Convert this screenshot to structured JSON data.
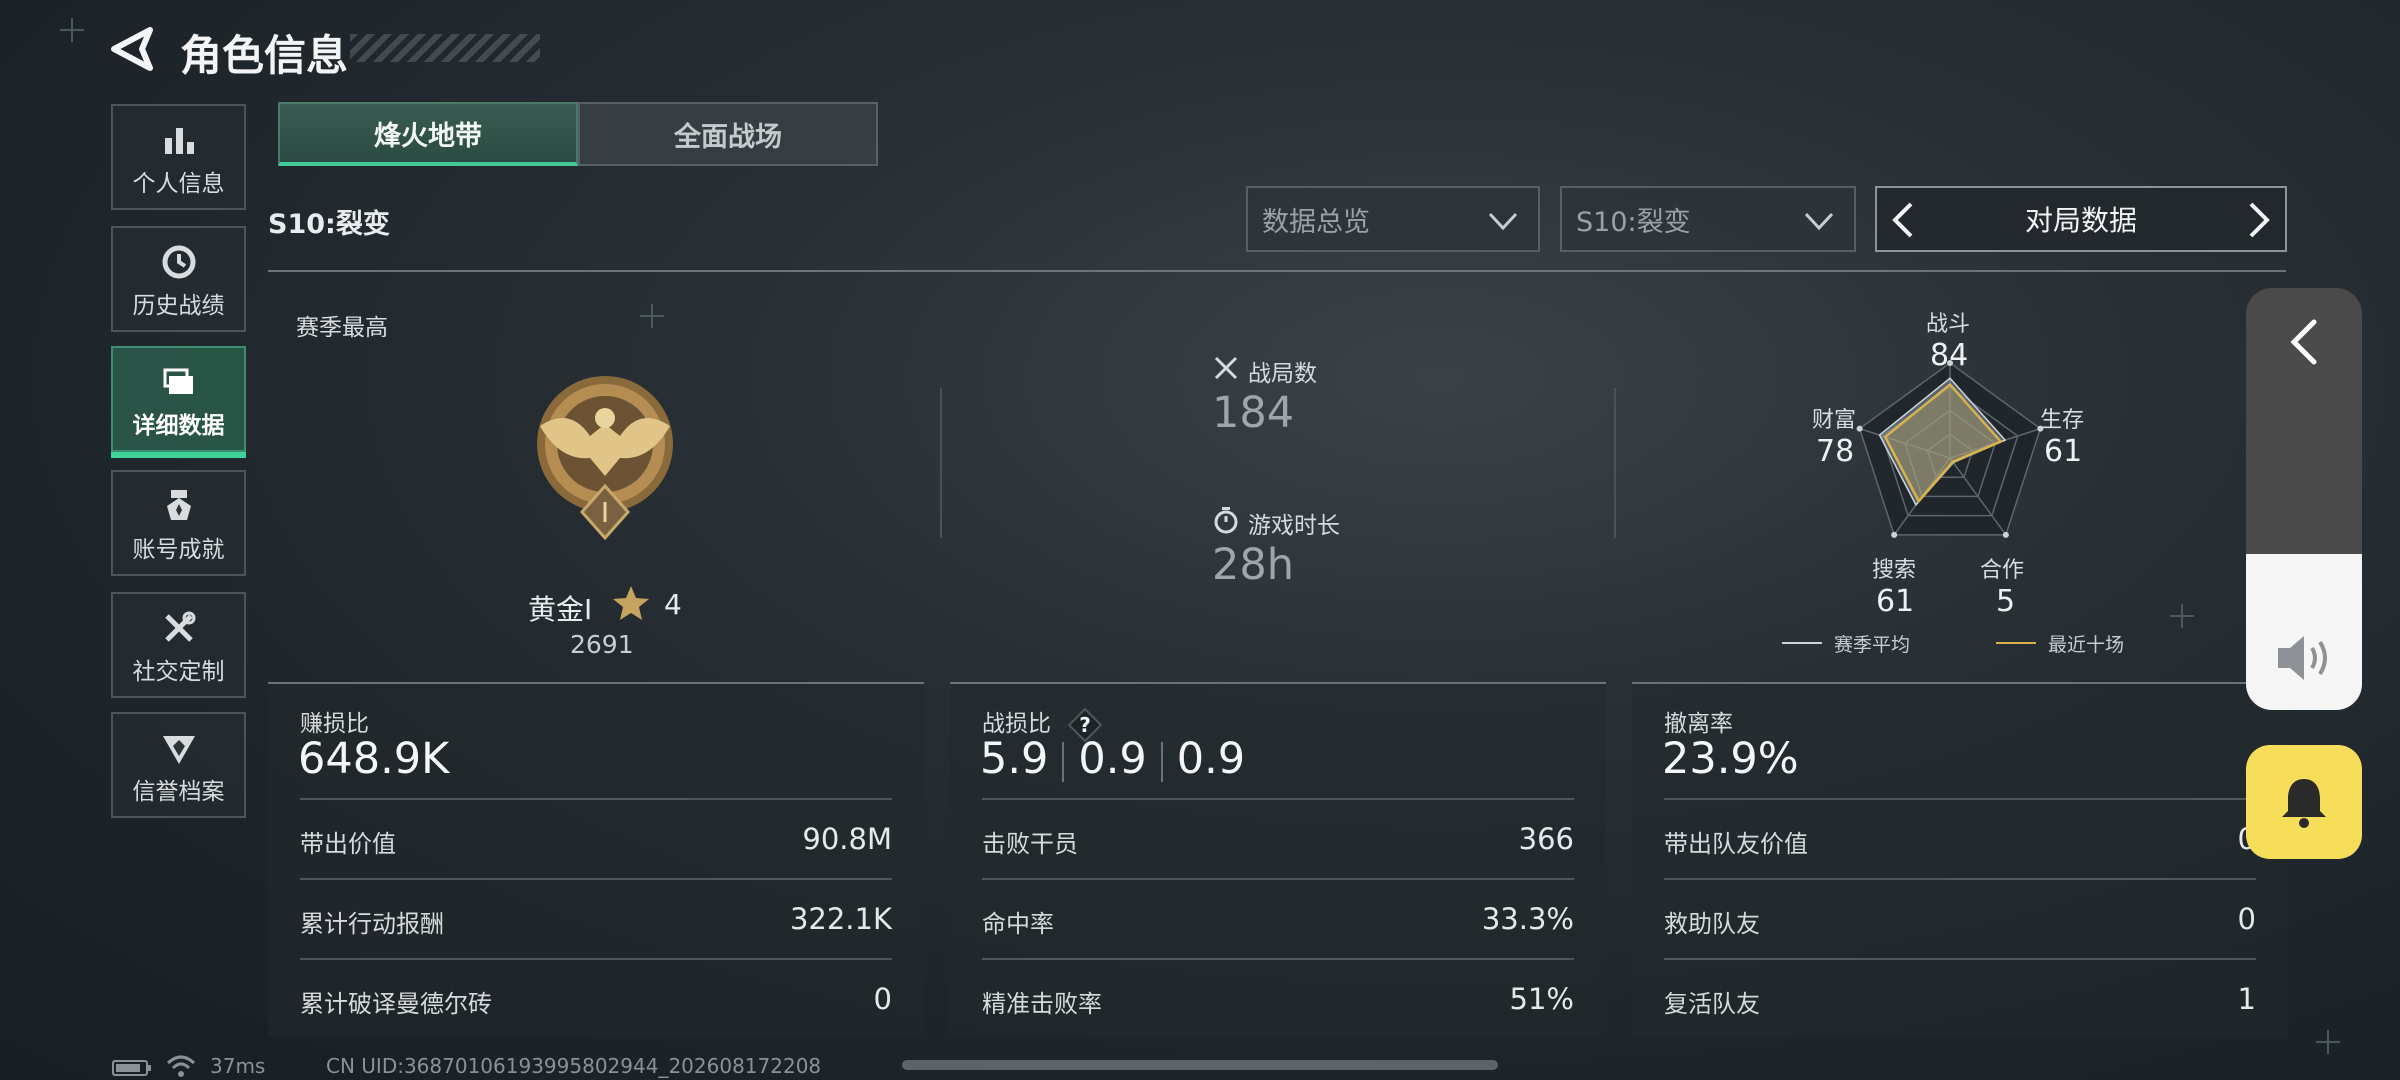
{
  "header": {
    "title": "角色信息",
    "back_icon": "back-arrow-icon"
  },
  "sidebar": {
    "items": [
      {
        "label": "个人信息",
        "icon": "bar-chart-icon",
        "active": false
      },
      {
        "label": "历史战绩",
        "icon": "clock-history-icon",
        "active": false
      },
      {
        "label": "详细数据",
        "icon": "folder-stack-icon",
        "active": true
      },
      {
        "label": "账号成就",
        "icon": "medal-badge-icon",
        "active": false
      },
      {
        "label": "社交定制",
        "icon": "wrench-tools-icon",
        "active": false
      },
      {
        "label": "信誉档案",
        "icon": "shield-emblem-icon",
        "active": false
      }
    ]
  },
  "mode_tabs": {
    "active": "烽火地带",
    "inactive": "全面战场"
  },
  "season_label": "S10:裂变",
  "filters": {
    "overview": "数据总览",
    "season": "S10:裂变",
    "match_data": "对局数据"
  },
  "summary": {
    "season_best_label": "赛季最高",
    "rank_name": "黄金Ⅰ",
    "rank_stars": "4",
    "rank_points": "2691",
    "matches_label": "战局数",
    "matches_value": "184",
    "playtime_label": "游戏时长",
    "playtime_value": "28h"
  },
  "radar": {
    "labels": {
      "combat": "战斗",
      "survival": "生存",
      "cooperation": "合作",
      "search": "搜索",
      "wealth": "财富"
    },
    "values": {
      "combat": "84",
      "survival": "61",
      "cooperation": "5",
      "search": "61",
      "wealth": "78"
    },
    "legend_season": "赛季平均",
    "legend_recent": "最近十场",
    "season_color": "#d0d4d6",
    "recent_color": "#d9b24a"
  },
  "cards": [
    {
      "head_label": "赚损比",
      "head_value": "648.9K",
      "rows": [
        {
          "k": "带出价值",
          "v": "90.8M"
        },
        {
          "k": "累计行动报酬",
          "v": "322.1K"
        },
        {
          "k": "累计破译曼德尔砖",
          "v": "0"
        }
      ]
    },
    {
      "head_label": "战损比",
      "help_icon": "question-diamond-icon",
      "head_values": [
        "5.9",
        "0.9",
        "0.9"
      ],
      "rows": [
        {
          "k": "击败干员",
          "v": "366"
        },
        {
          "k": "命中率",
          "v": "33.3%"
        },
        {
          "k": "精准击败率",
          "v": "51%"
        }
      ]
    },
    {
      "head_label": "撤离率",
      "head_value": "23.9%",
      "rows": [
        {
          "k": "带出队友价值",
          "v": "0"
        },
        {
          "k": "救助队友",
          "v": "0"
        },
        {
          "k": "复活队友",
          "v": "1"
        }
      ]
    }
  ],
  "volume_panel": {
    "level": 0.37,
    "bell_color": "#f6dd5a"
  },
  "status_bar": {
    "ping": "37ms",
    "uid": "CN UID:36870106193995802944_202608172208"
  }
}
